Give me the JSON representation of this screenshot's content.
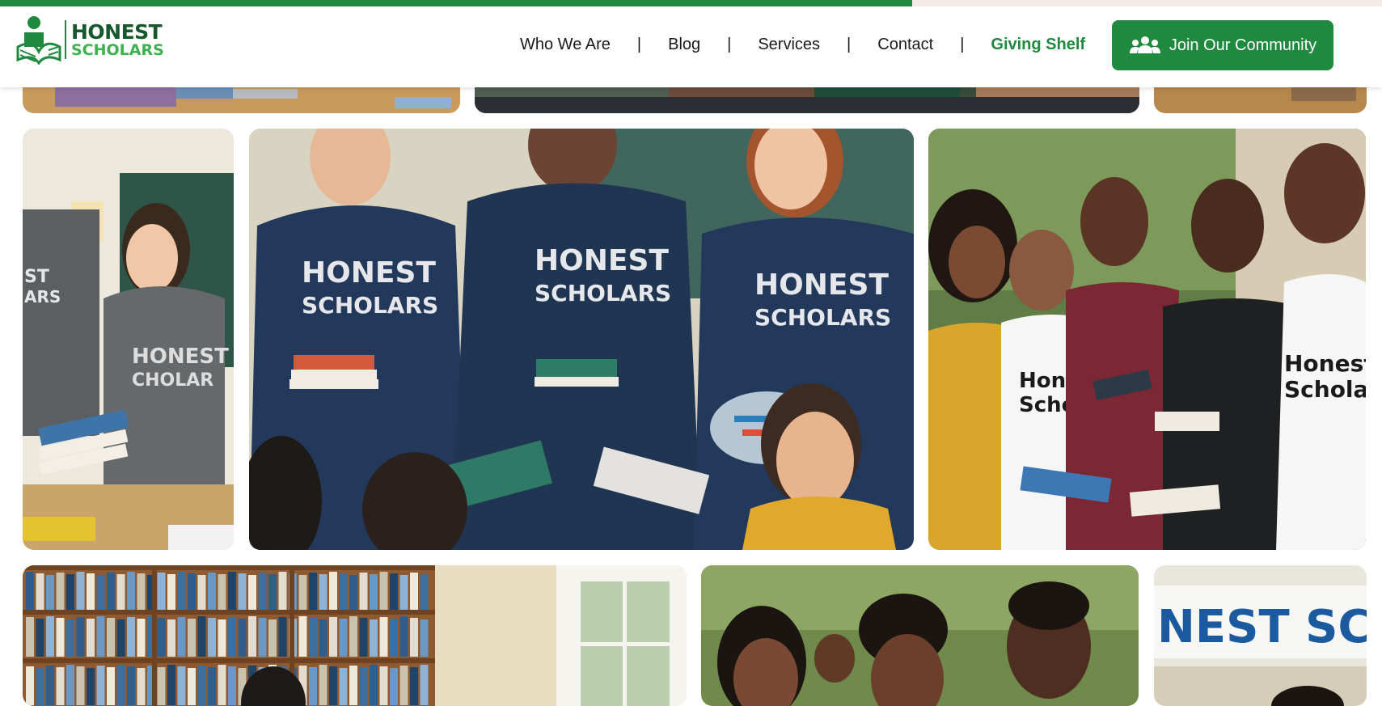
{
  "page": {
    "scroll_progress_percent": 66
  },
  "brand": {
    "line1": "HONEST",
    "line2": "SCHOLARS",
    "primary_color": "#1f8a3f",
    "secondary_color": "#3fb04f"
  },
  "nav": {
    "items": [
      {
        "label": "Who We Are"
      },
      {
        "label": "Blog"
      },
      {
        "label": "Services"
      },
      {
        "label": "Contact"
      },
      {
        "label": "Giving Shelf",
        "active": true
      }
    ],
    "separator": "|"
  },
  "cta": {
    "label": "Join Our Community",
    "icon": "community-icon"
  },
  "gallery": {
    "shirt_text_line1": "HONEST",
    "shirt_text_line2": "SCHOLARS",
    "mixed_shirt_line1": "Honest",
    "mixed_shirt_line2": "Scholars",
    "banner_text": "NEST SCHOL"
  }
}
